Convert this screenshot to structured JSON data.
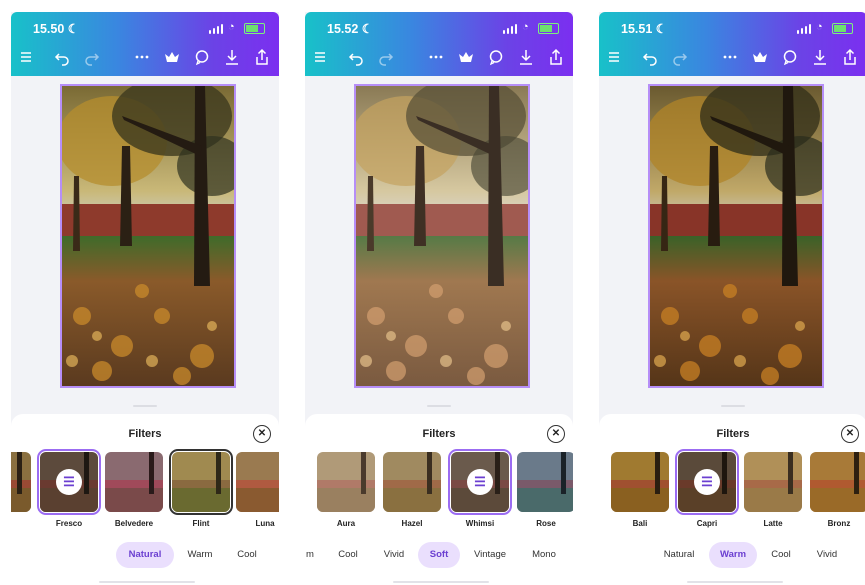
{
  "colors": {
    "accent": "#9b6cf2",
    "active_tab_bg": "#eadffd",
    "active_tab_text": "#6b3fd1"
  },
  "toolbar_icons": [
    "menu-icon",
    "undo-icon",
    "redo-icon",
    "more-icon",
    "crown-icon",
    "comment-icon",
    "download-icon",
    "share-icon"
  ],
  "screens": [
    {
      "time": "15.50",
      "sheet_title": "Filters",
      "close_glyph": "✕",
      "filters": [
        {
          "label": "",
          "state": "normal",
          "tone": "natural"
        },
        {
          "label": "Fresco",
          "state": "selected",
          "tone": "fresco"
        },
        {
          "label": "Belvedere",
          "state": "normal",
          "tone": "belvedere"
        },
        {
          "label": "Flint",
          "state": "outlined",
          "tone": "flint"
        },
        {
          "label": "Luna",
          "state": "normal",
          "tone": "luna"
        }
      ],
      "tabs": [
        {
          "label": "Natural",
          "active": true
        },
        {
          "label": "Warm",
          "active": false
        },
        {
          "label": "Cool",
          "active": false
        }
      ]
    },
    {
      "time": "15.52",
      "sheet_title": "Filters",
      "close_glyph": "✕",
      "filters": [
        {
          "label": "Aura",
          "state": "normal",
          "tone": "aura"
        },
        {
          "label": "Hazel",
          "state": "normal",
          "tone": "hazel"
        },
        {
          "label": "Whimsi",
          "state": "selected",
          "tone": "whimsi"
        },
        {
          "label": "Rose",
          "state": "normal",
          "tone": "rose"
        }
      ],
      "tabs": [
        {
          "label": "m",
          "active": false
        },
        {
          "label": "Cool",
          "active": false
        },
        {
          "label": "Vivid",
          "active": false
        },
        {
          "label": "Soft",
          "active": true
        },
        {
          "label": "Vintage",
          "active": false
        },
        {
          "label": "Mono",
          "active": false
        }
      ]
    },
    {
      "time": "15.51",
      "sheet_title": "Filters",
      "close_glyph": "✕",
      "filters": [
        {
          "label": "Bali",
          "state": "normal",
          "tone": "bali"
        },
        {
          "label": "Capri",
          "state": "selected",
          "tone": "capri"
        },
        {
          "label": "Latte",
          "state": "normal",
          "tone": "latte"
        },
        {
          "label": "Bronz",
          "state": "normal",
          "tone": "bronz"
        }
      ],
      "tabs": [
        {
          "label": "Natural",
          "active": false
        },
        {
          "label": "Warm",
          "active": true
        },
        {
          "label": "Cool",
          "active": false
        },
        {
          "label": "Vivid",
          "active": false
        },
        {
          "label": "",
          "active": false
        }
      ]
    }
  ]
}
